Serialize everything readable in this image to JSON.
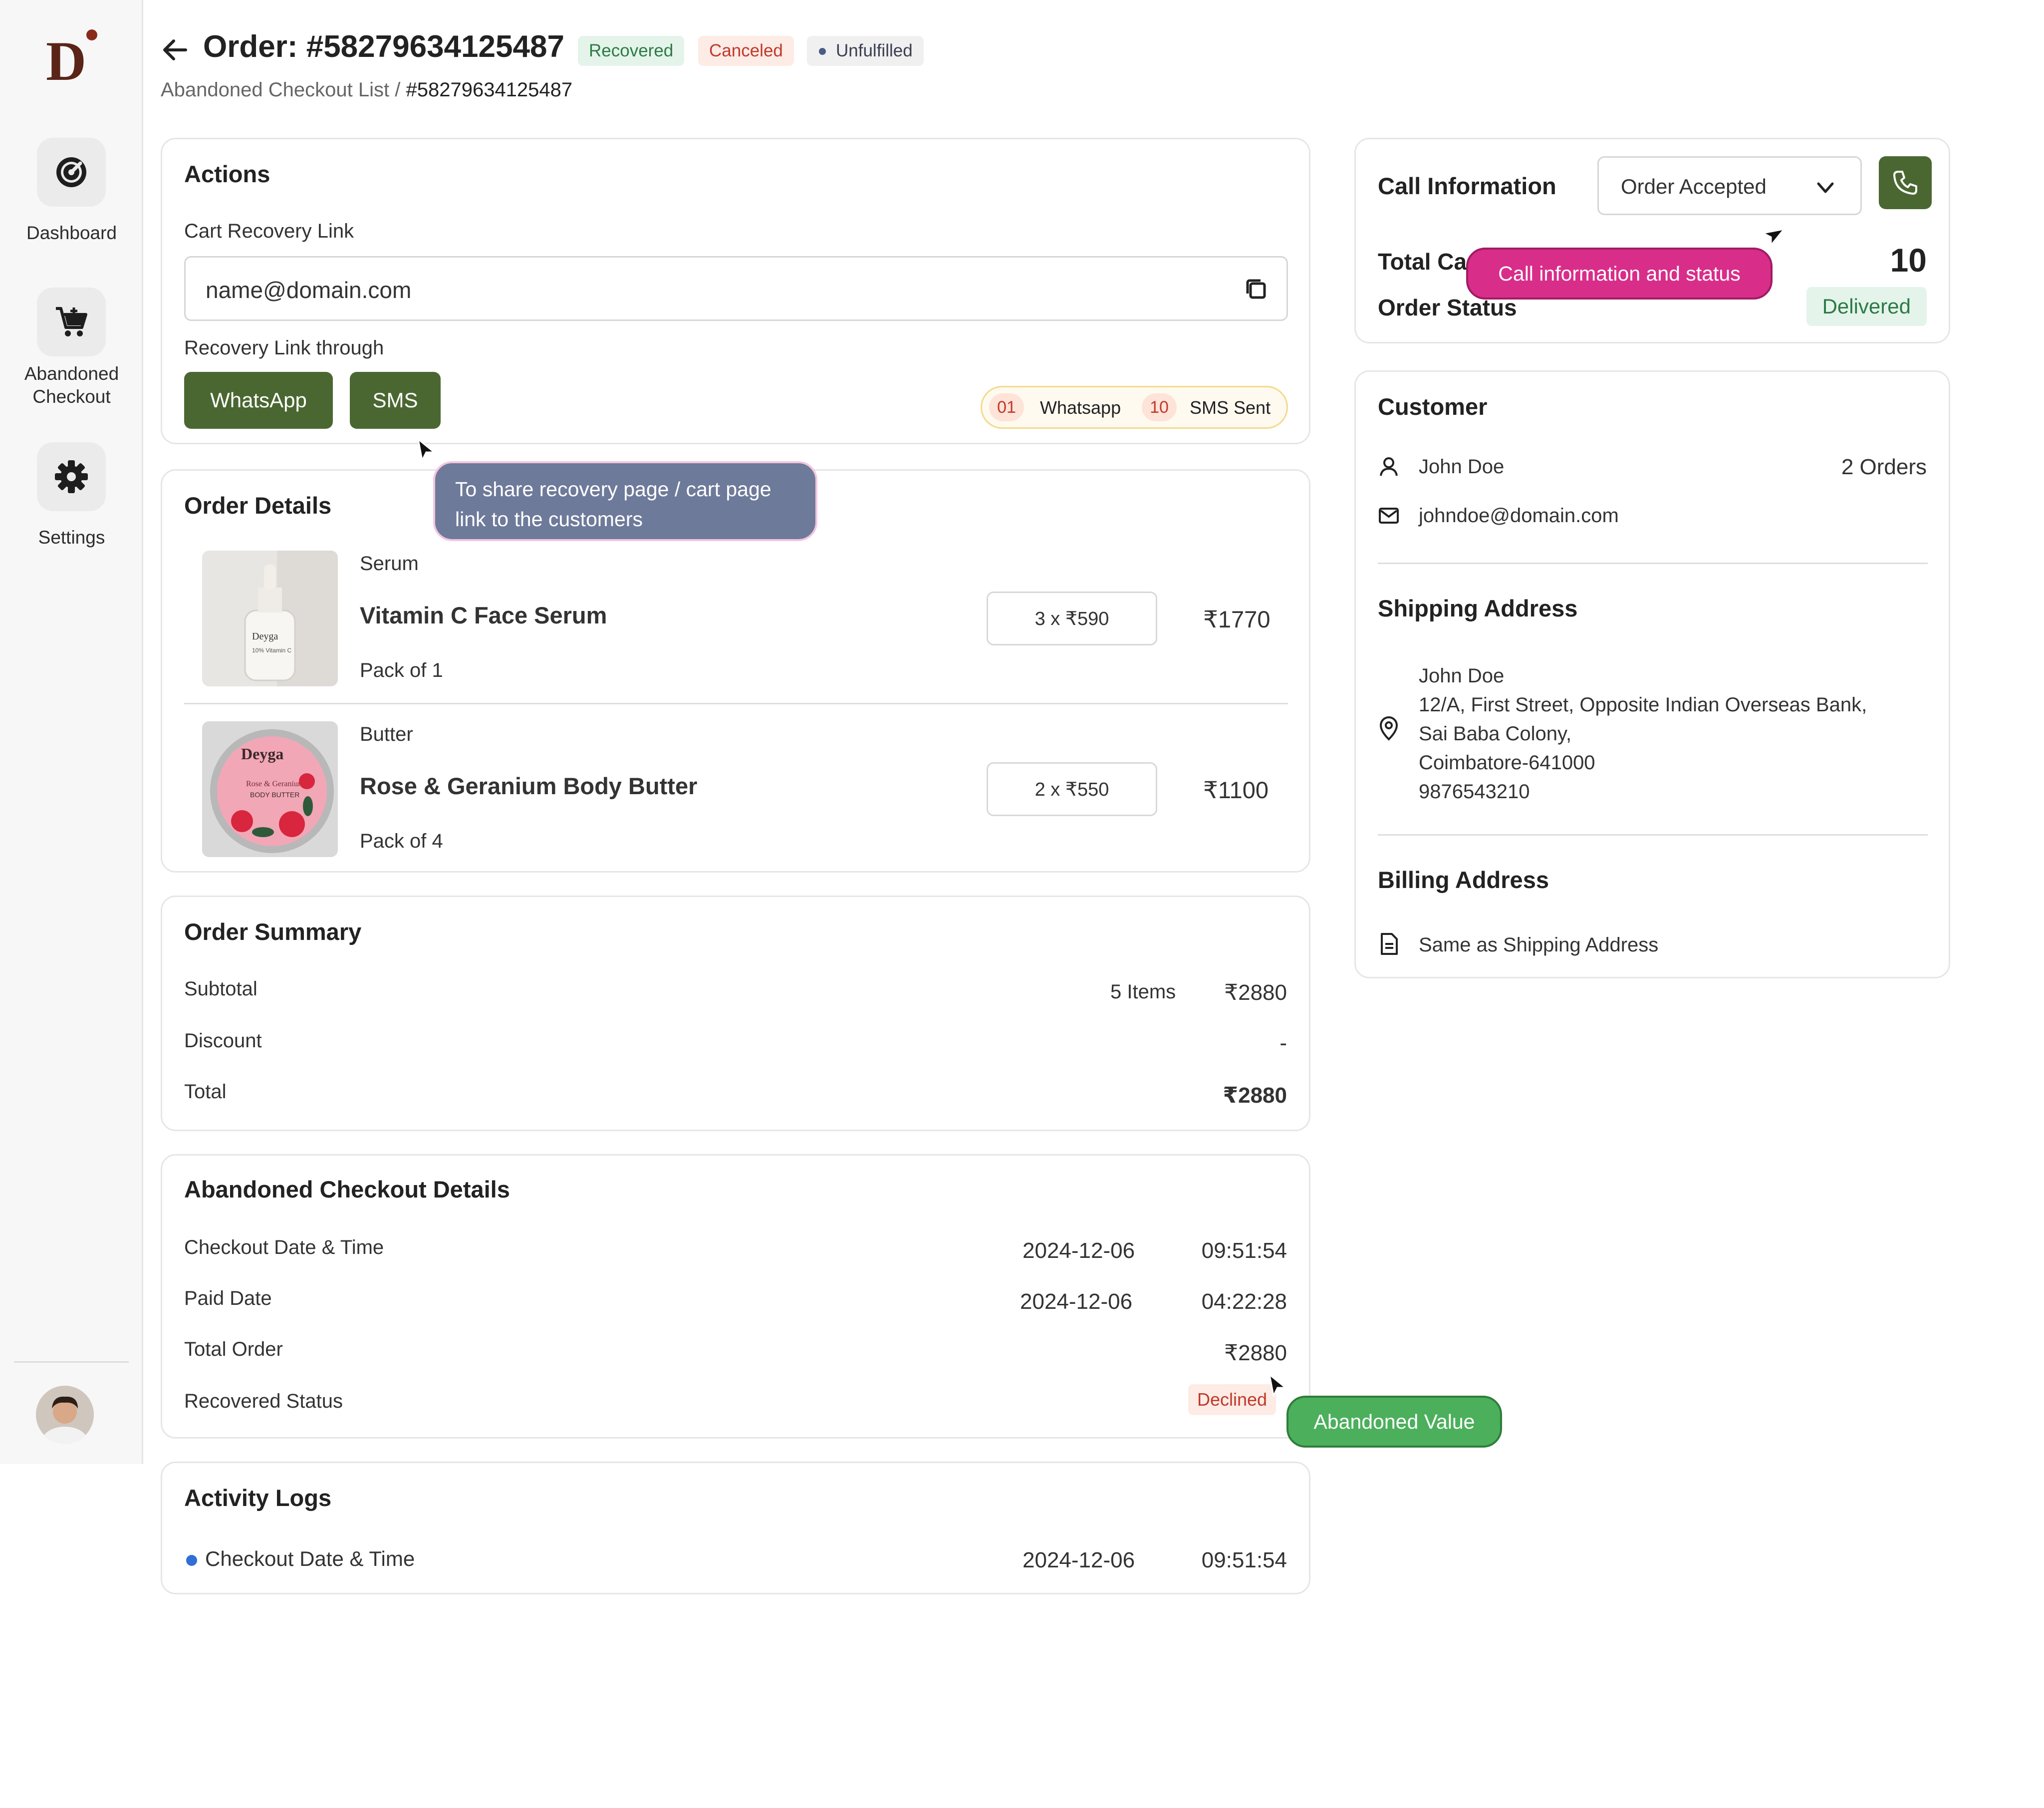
{
  "sidebar": {
    "logo": "D",
    "items": [
      {
        "label": "Dashboard",
        "icon": "dashboard-gauge-icon"
      },
      {
        "label": "Abandoned Checkout",
        "icon": "cart-icon"
      },
      {
        "label": "Settings",
        "icon": "gear-icon"
      }
    ],
    "avatar": "user-avatar"
  },
  "header": {
    "title": "Order: #58279634125487",
    "badges": {
      "recovered": "Recovered",
      "canceled": "Canceled",
      "unfulfilled": "Unfulfilled"
    },
    "breadcrumb_parent": "Abandoned Checkout List /",
    "breadcrumb_current": "#58279634125487"
  },
  "actions": {
    "title": "Actions",
    "cart_link_label": "Cart Recovery Link",
    "cart_link_value": "name@domain.com",
    "through_label": "Recovery Link through",
    "whatsapp_button": "WhatsApp",
    "sms_button": "SMS",
    "whatsapp_count": "01",
    "whatsapp_text": "Whatsapp",
    "sms_count": "10",
    "sms_text": "SMS Sent",
    "tooltip_line1": "To share recovery page / cart page",
    "tooltip_line2": "link to the customers"
  },
  "order_details": {
    "title": "Order Details",
    "items": [
      {
        "category": "Serum",
        "name": "Vitamin C Face Serum",
        "pack": "Pack of 1",
        "qty": "3 x ₹590",
        "total": "₹1770"
      },
      {
        "category": "Butter",
        "name": "Rose & Geranium Body Butter",
        "pack": "Pack of 4",
        "qty": "2 x ₹550",
        "total": "₹1100"
      }
    ]
  },
  "order_summary": {
    "title": "Order Summary",
    "subtotal_label": "Subtotal",
    "items_count": "5 Items",
    "subtotal_value": "₹2880",
    "discount_label": "Discount",
    "discount_value": "-",
    "total_label": "Total",
    "total_value": "₹2880"
  },
  "abandoned": {
    "title": "Abandoned Checkout Details",
    "checkout_label": "Checkout Date & Time",
    "checkout_date": "2024-12-06",
    "checkout_time": "09:51:54",
    "paid_label": "Paid Date",
    "paid_date": "2024-12-06",
    "paid_time": "04:22:28",
    "total_order_label": "Total Order",
    "total_order_value": "₹2880",
    "recovered_label": "Recovered Status",
    "recovered_value": "Declined",
    "tooltip": "Abandoned Value"
  },
  "activity": {
    "title": "Activity Logs",
    "entry_label": "Checkout Date & Time",
    "entry_date": "2024-12-06",
    "entry_time": "09:51:54"
  },
  "call_info": {
    "title": "Call Information",
    "dropdown_value": "Order Accepted",
    "total_calls_label": "Total Ca",
    "total_calls_value": "10",
    "order_status_label": "Order Status",
    "order_status_value": "Delivered",
    "tooltip": "Call information and status"
  },
  "customer": {
    "title": "Customer",
    "name": "John Doe",
    "orders": "2 Orders",
    "email": "johndoe@domain.com",
    "shipping_title": "Shipping Address",
    "ship_name": "John Doe",
    "ship_line1": "12/A, First Street, Opposite Indian Overseas Bank,",
    "ship_line2": "Sai Baba Colony,",
    "ship_line3": "Coimbatore-641000",
    "ship_phone": "9876543210",
    "billing_title": "Billing Address",
    "billing_value": "Same as Shipping Address"
  },
  "colors": {
    "accent_green": "#4a6731",
    "tooltip_pink": "#d92d8a",
    "tooltip_green": "#4caf5c",
    "tooltip_slate": "#6e7a9a"
  }
}
